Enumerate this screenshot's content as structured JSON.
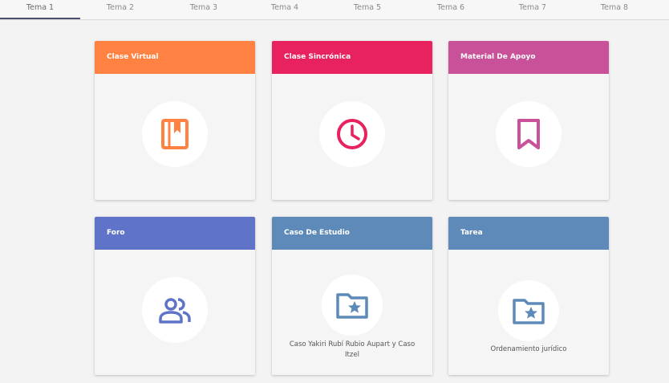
{
  "tabs": [
    {
      "label": "Tema 1",
      "active": true
    },
    {
      "label": "Tema 2",
      "active": false
    },
    {
      "label": "Tema 3",
      "active": false
    },
    {
      "label": "Tema 4",
      "active": false
    },
    {
      "label": "Tema 5",
      "active": false
    },
    {
      "label": "Tema 6",
      "active": false
    },
    {
      "label": "Tema 7",
      "active": false
    },
    {
      "label": "Tema 8",
      "active": false
    }
  ],
  "cards": [
    {
      "title": "Clase Virtual",
      "color": "#ff8243",
      "icon": "book-icon",
      "caption": ""
    },
    {
      "title": "Clase Sincrónica",
      "color": "#e8215f",
      "icon": "clock-icon",
      "caption": ""
    },
    {
      "title": "Material De Apoyo",
      "color": "#c9519a",
      "icon": "bookmark-icon",
      "caption": ""
    },
    {
      "title": "Foro",
      "color": "#5f73c8",
      "icon": "people-icon",
      "caption": ""
    },
    {
      "title": "Caso De Estudio",
      "color": "#5d8ab8",
      "icon": "folder-star-icon",
      "caption": "Caso Yakiri Rubí Rubio Aupart y Caso Itzel"
    },
    {
      "title": "Tarea",
      "color": "#5d8ab8",
      "icon": "folder-star-icon",
      "caption": "Ordenamiento jurídico"
    }
  ]
}
